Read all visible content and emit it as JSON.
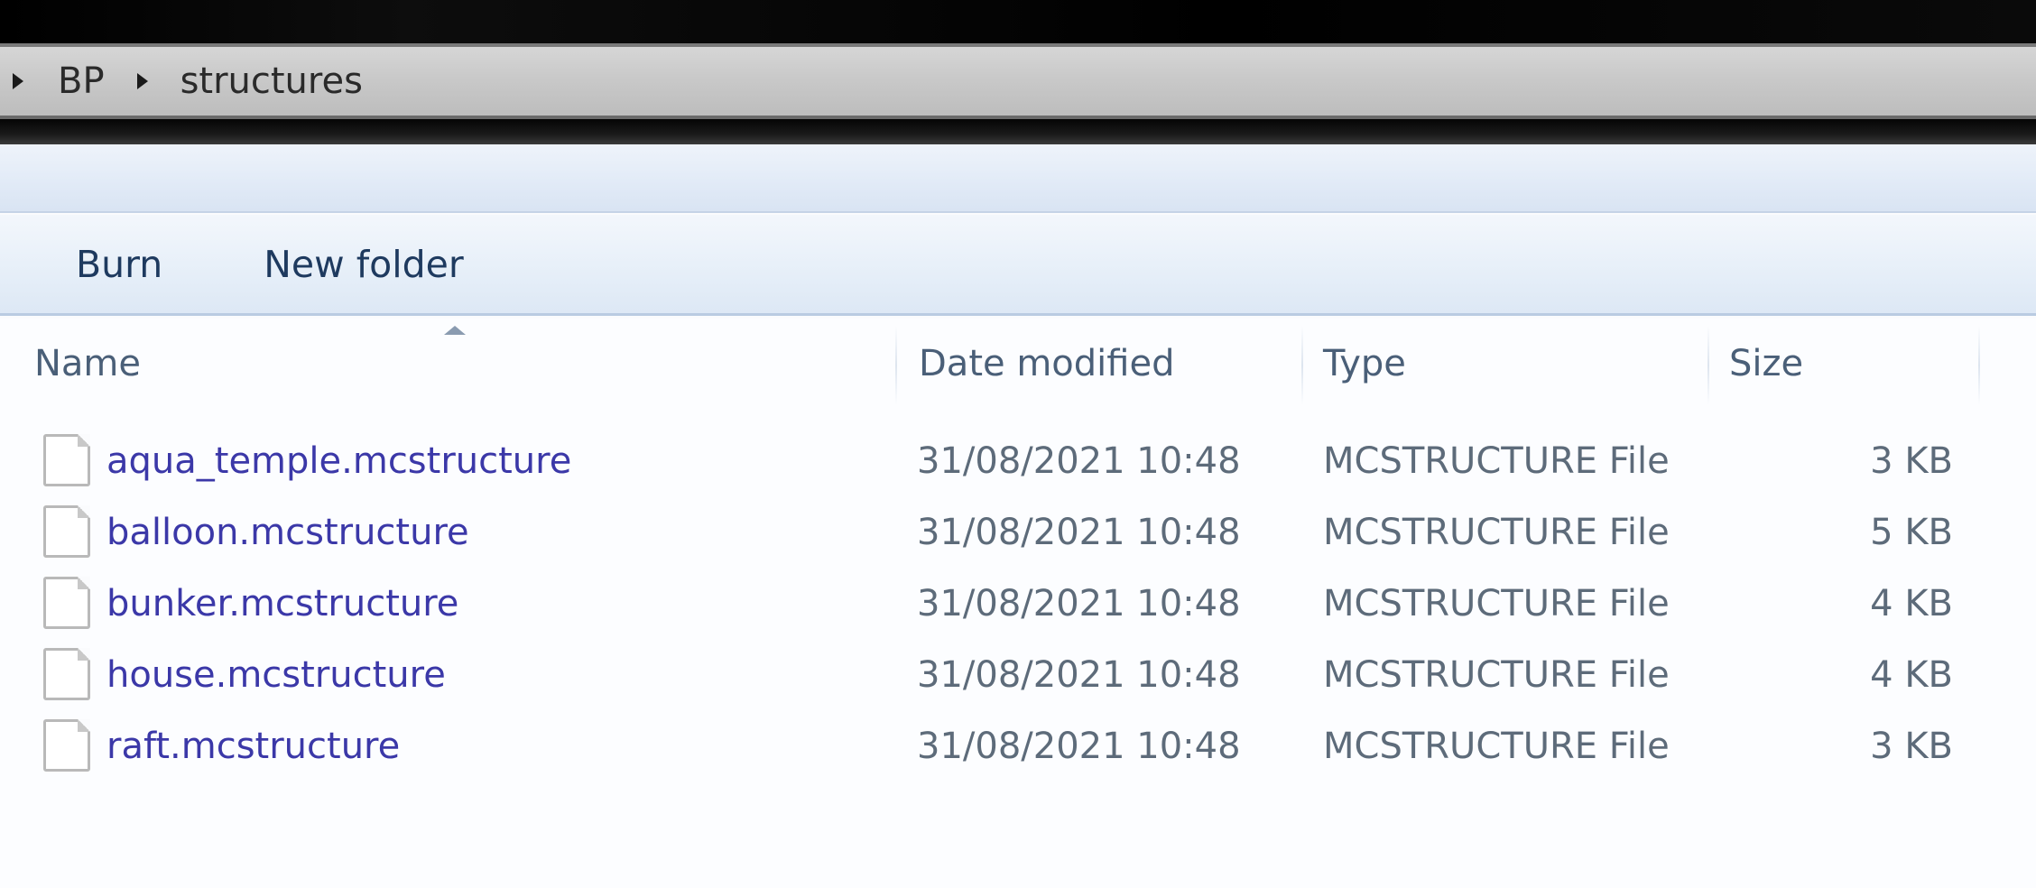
{
  "address_bar": {
    "crumbs": [
      {
        "label": "BP"
      },
      {
        "label": "structures"
      }
    ]
  },
  "toolbar": {
    "burn_label": "Burn",
    "new_folder_label": "New folder"
  },
  "file_list": {
    "columns": {
      "name": "Name",
      "date": "Date modified",
      "type": "Type",
      "size": "Size"
    },
    "sort_column": "Name",
    "rows": [
      {
        "name": "aqua_temple.mcstructure",
        "date": "31/08/2021 10:48",
        "type": "MCSTRUCTURE File",
        "size": "3 KB"
      },
      {
        "name": "balloon.mcstructure",
        "date": "31/08/2021 10:48",
        "type": "MCSTRUCTURE File",
        "size": "5 KB"
      },
      {
        "name": "bunker.mcstructure",
        "date": "31/08/2021 10:48",
        "type": "MCSTRUCTURE File",
        "size": "4 KB"
      },
      {
        "name": "house.mcstructure",
        "date": "31/08/2021 10:48",
        "type": "MCSTRUCTURE File",
        "size": "4 KB"
      },
      {
        "name": "raft.mcstructure",
        "date": "31/08/2021 10:48",
        "type": "MCSTRUCTURE File",
        "size": "3 KB"
      }
    ]
  },
  "colors": {
    "file_name_text": "#3b38a8",
    "detail_text": "#5d6b7a",
    "toolbar_text": "#1e3a5f"
  },
  "icons": {
    "breadcrumb_separator": "chevron-right-icon",
    "file": "document-icon",
    "sort": "sort-ascending-icon"
  }
}
